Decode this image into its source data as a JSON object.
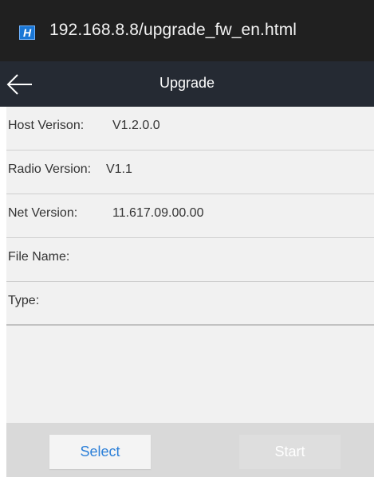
{
  "browser": {
    "site_icon_letter": "H",
    "url": "192.168.8.8/upgrade_fw_en.html"
  },
  "header": {
    "title": "Upgrade"
  },
  "info": {
    "host_version": {
      "label": "Host Verison:",
      "value": "V1.2.0.0"
    },
    "radio_version": {
      "label": "Radio Version:",
      "value": "V1.1"
    },
    "net_version": {
      "label": "Net Version:",
      "value": "11.617.09.00.00"
    },
    "file_name": {
      "label": "File Name:",
      "value": ""
    },
    "type": {
      "label": "Type:",
      "value": ""
    }
  },
  "actions": {
    "select_label": "Select",
    "start_label": "Start",
    "start_enabled": false
  },
  "colors": {
    "url_bar_bg": "#202020",
    "header_bg": "#252a33",
    "content_bg": "#f1f1f1",
    "select_text": "#2b7fd8",
    "action_bar_bg": "#d9d9d9"
  },
  "icons": {
    "site": "site-favicon-icon",
    "back": "arrow-left-icon"
  }
}
